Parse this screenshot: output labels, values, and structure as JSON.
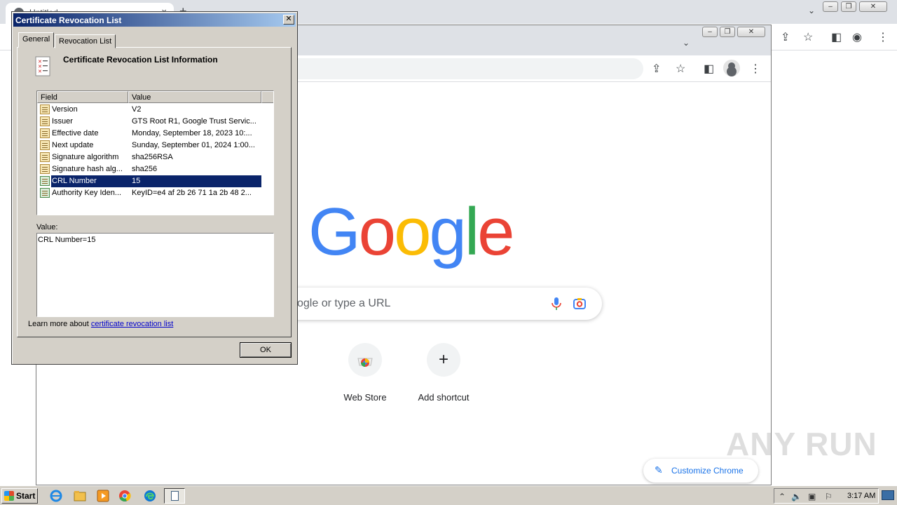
{
  "outer_browser": {
    "tab_title": "Untitled",
    "tab_close": "×",
    "new_tab": "+",
    "minimize": "–",
    "maximize": "❐",
    "close": "✕",
    "tab_search": "⌄"
  },
  "inner_browser": {
    "minimize": "–",
    "maximize": "❐",
    "close": "✕",
    "tab_search": "⌄",
    "search_placeholder": "ogle or type a URL",
    "logo_letters": [
      {
        "char": "G",
        "color": "#4285f4"
      },
      {
        "char": "o",
        "color": "#ea4335"
      },
      {
        "char": "o",
        "color": "#fbbc05"
      },
      {
        "char": "g",
        "color": "#4285f4"
      },
      {
        "char": "l",
        "color": "#34a853"
      },
      {
        "char": "e",
        "color": "#ea4335"
      }
    ],
    "shortcuts": [
      {
        "label": "Web Store",
        "icon": "chrome-web-store-icon"
      },
      {
        "label": "Add shortcut",
        "icon": "plus-icon",
        "glyph": "+"
      }
    ],
    "customize_label": "Customize Chrome",
    "customize_icon": "✎"
  },
  "watermark": "ANY RUN",
  "dialog": {
    "title": "Certificate Revocation List",
    "close": "✕",
    "tabs": [
      "General",
      "Revocation List"
    ],
    "info_title": "Certificate Revocation List Information",
    "columns": [
      "Field",
      "Value"
    ],
    "rows": [
      {
        "field": "Version",
        "value": "V2",
        "icon": "field-icon"
      },
      {
        "field": "Issuer",
        "value": "GTS Root R1, Google Trust Servic...",
        "icon": "field-icon"
      },
      {
        "field": "Effective date",
        "value": "Monday, September 18, 2023 10:...",
        "icon": "field-icon"
      },
      {
        "field": "Next update",
        "value": "Sunday, September 01, 2024 1:00...",
        "icon": "field-icon"
      },
      {
        "field": "Signature algorithm",
        "value": "sha256RSA",
        "icon": "field-icon"
      },
      {
        "field": "Signature hash alg...",
        "value": "sha256",
        "icon": "field-icon"
      },
      {
        "field": "CRL Number",
        "value": "15",
        "icon": "extension-icon",
        "selected": true
      },
      {
        "field": "Authority Key Iden...",
        "value": "KeyID=e4 af 2b 26 71 1a 2b 48 2...",
        "icon": "extension-icon"
      }
    ],
    "value_label": "Value:",
    "value_text": "CRL Number=15",
    "learn_more_prefix": "Learn more about ",
    "learn_more_link": "certificate revocation list",
    "ok_label": "OK"
  },
  "taskbar": {
    "start_label": "Start",
    "clock": "3:17 AM"
  }
}
